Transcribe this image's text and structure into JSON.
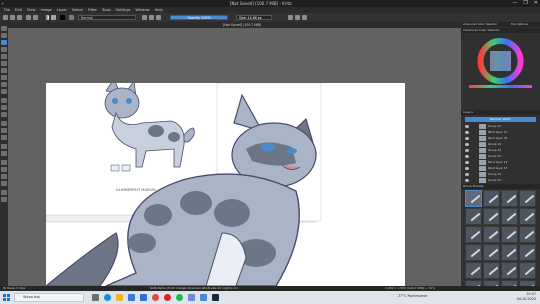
{
  "window": {
    "title": "[Not Saved] (100.7 MiB) - Krita",
    "controls": [
      "—",
      "❐",
      "✕"
    ]
  },
  "menu": [
    "File",
    "Edit",
    "View",
    "Image",
    "Layer",
    "Select",
    "Filter",
    "Tools",
    "Settings",
    "Window",
    "Help"
  ],
  "toolbar": {
    "blend_mode": "Normal",
    "opacity": "Opacity: 100%",
    "size": "Size: 14.66 px"
  },
  "document": {
    "tab_title": "[Not Saved] (100.7 MiB)",
    "reference_label": "GLIMMERPELT MARGIN"
  },
  "dock": {
    "tabs": [
      "Advanced Color Selector",
      "Tool Options"
    ],
    "color_panel_title": "Advanced Color Selector",
    "layers_title": "Layers",
    "blend_row": "Normal  100%",
    "layers": [
      "Group 24",
      "Paint layer 27",
      "Paint layer 36",
      "Group 19",
      "Group 20",
      "Group 15",
      "Paint layer 14",
      "Paint layer 13",
      "Group 14",
      "Group 15"
    ],
    "brush_presets_title": "Brush Presets"
  },
  "status": {
    "left": "B) Basic-5 Size",
    "center": "RGB/Alpha (8-bit integer/channel)  sRGB-elle-V2-srgbtrc.icc",
    "right": "1,200 x 1,500 (100.7 MiB)   ← 51%"
  },
  "taskbar": {
    "search_placeholder": "Wyszukaj",
    "weather": "27°C  Pochmurnie",
    "time": "20:57",
    "date": "04.10.2020"
  },
  "colors": {
    "accent": "#4a8ad1",
    "cat_fur": "#a9b5c7",
    "cat_dark": "#6d7686",
    "cat_outline": "#4b4a6e"
  }
}
